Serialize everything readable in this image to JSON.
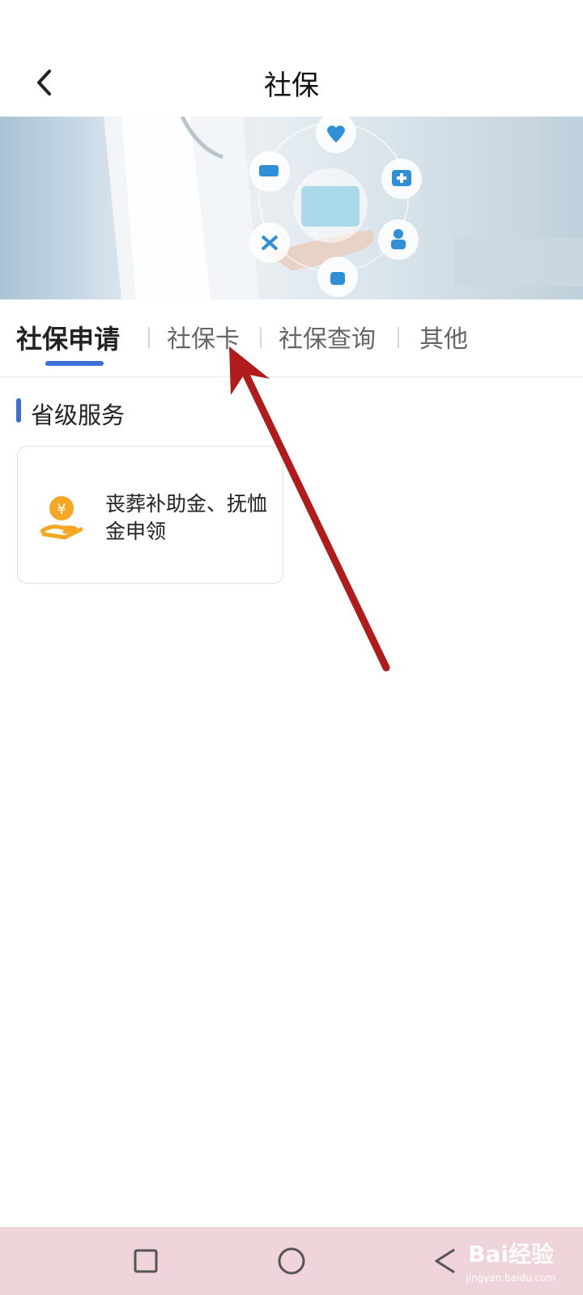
{
  "header": {
    "title": "社保"
  },
  "tabs": [
    {
      "label": "社保申请",
      "active": true
    },
    {
      "label": "社保卡",
      "active": false
    },
    {
      "label": "社保查询",
      "active": false
    },
    {
      "label": "其他",
      "active": false
    }
  ],
  "section": {
    "title": "省级服务"
  },
  "services": [
    {
      "label": "丧葬补助金、抚恤金申领",
      "icon": "yuan-hand-icon"
    }
  ],
  "watermark": {
    "brand": "Bai经验",
    "url": "jingyan.baidu.com"
  },
  "colors": {
    "accent": "#3d6fd8",
    "arrow": "#b01c1c",
    "icon_orange": "#f5a623",
    "nav_bar_bg": "#efd4da"
  }
}
